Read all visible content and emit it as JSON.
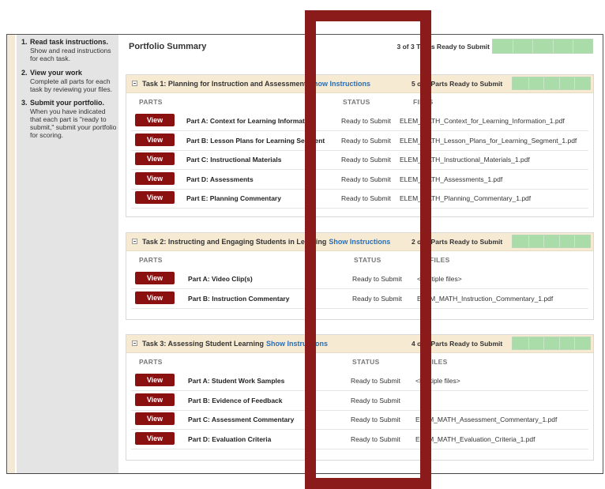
{
  "sidebar": {
    "steps": [
      {
        "num": "1.",
        "head": "Read task instructions.",
        "desc": "Show and read instructions for each task."
      },
      {
        "num": "2.",
        "head": "View your work",
        "desc": "Complete all parts for each task by reviewing your files."
      },
      {
        "num": "3.",
        "head": "Submit your portfolio.",
        "desc": "When you have indicated that each part is \"ready to submit,\" submit your portfolio for scoring."
      }
    ]
  },
  "summary": {
    "title": "Portfolio Summary",
    "ready_text": "3 of 3 Tasks Ready to Submit",
    "progress": 1.0
  },
  "columns": {
    "parts": "PARTS",
    "status": "STATUS",
    "files": "FILES"
  },
  "view_label": "View",
  "show_instructions": "Show Instructions",
  "tasks": [
    {
      "title": "Task 1: Planning for Instruction and Assessment",
      "ready_text": "5 of 5 Parts Ready to Submit",
      "parts": [
        {
          "name": "Part A: Context for Learning Information",
          "status": "Ready to Submit",
          "file": "ELEM_MATH_Context_for_Learning_Information_1.pdf"
        },
        {
          "name": "Part B: Lesson Plans for Learning Segment",
          "status": "Ready to Submit",
          "file": "ELEM_MATH_Lesson_Plans_for_Learning_Segment_1.pdf"
        },
        {
          "name": "Part C: Instructional Materials",
          "status": "Ready to Submit",
          "file": "ELEM_MATH_Instructional_Materials_1.pdf"
        },
        {
          "name": "Part D: Assessments",
          "status": "Ready to Submit",
          "file": "ELEM_MATH_Assessments_1.pdf"
        },
        {
          "name": "Part E: Planning Commentary",
          "status": "Ready to Submit",
          "file": "ELEM_MATH_Planning_Commentary_1.pdf"
        }
      ]
    },
    {
      "title": "Task 2: Instructing and Engaging Students in Learning",
      "ready_text": "2 of 2 Parts Ready to Submit",
      "parts": [
        {
          "name": "Part A: Video Clip(s)",
          "status": "Ready to Submit",
          "file": "<Multiple files>"
        },
        {
          "name": "Part B: Instruction Commentary",
          "status": "Ready to Submit",
          "file": "ELEM_MATH_Instruction_Commentary_1.pdf"
        }
      ]
    },
    {
      "title": "Task 3: Assessing Student Learning",
      "ready_text": "4 of 4 Parts Ready to Submit",
      "parts": [
        {
          "name": "Part A: Student Work Samples",
          "status": "Ready to Submit",
          "file": "<Multiple files>"
        },
        {
          "name": "Part B: Evidence of Feedback",
          "status": "Ready to Submit",
          "file": ""
        },
        {
          "name": "Part C: Assessment Commentary",
          "status": "Ready to Submit",
          "file": "ELEM_MATH_Assessment_Commentary_1.pdf"
        },
        {
          "name": "Part D: Evaluation Criteria",
          "status": "Ready to Submit",
          "file": "ELEM_MATH_Evaluation_Criteria_1.pdf"
        }
      ]
    }
  ],
  "colors": {
    "view_button": "#8b1010",
    "link": "#2a6db5",
    "progress": "#a9dca9",
    "task_header": "#f7ead3",
    "overlay": "#8b1a1a"
  }
}
